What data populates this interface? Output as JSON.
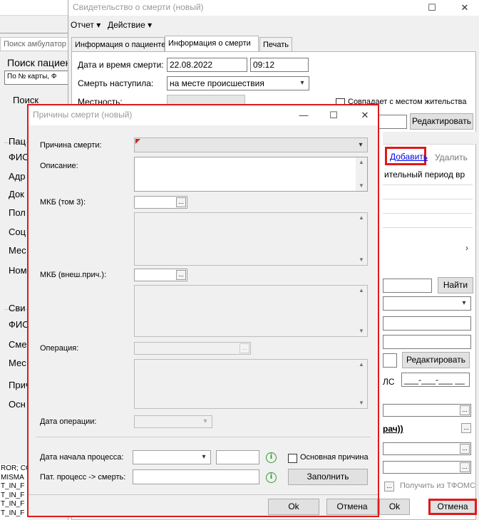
{
  "background_app": {
    "search_tab": "Поиск амбулатор",
    "panel_title": "Поиск пациен",
    "search_combo": "По № карты, Ф",
    "search_label": "Поиск",
    "patient_group": "Пац",
    "patient_fields": [
      "ФИО",
      "Адр",
      "Док",
      "Пол",
      "Соц",
      "Мес",
      "Ном"
    ],
    "visit_group": "Сви",
    "visit_fields": [
      "ФИО",
      "Сме",
      "Мес",
      "Прич",
      "Осн"
    ],
    "error_lines": [
      "ROR; CO",
      "MISMA",
      "T_IN_F",
      "T_IN_F",
      "T_IN_F",
      "T_IN_F"
    ]
  },
  "certificate_window": {
    "title": "Свидетельство о смерти (новый)",
    "menu": [
      "Отчет",
      "Действие"
    ],
    "tabs": [
      "Информация о пациенте",
      "Информация о смерти",
      "Печать"
    ],
    "death_datetime_label": "Дата и время смерти:",
    "death_date": "22.08.2022",
    "death_time": "09:12",
    "death_occurred_label": "Смерть наступила:",
    "death_occurred_value": "на месте происшествия",
    "locality_label": "Местность:",
    "same_as_residence_label": "Совпадает с местом жительства",
    "edit_button": "Редактировать",
    "add_link": "Добавить",
    "delete_link": "Удалить",
    "column_header": "ительный период вр",
    "find_button": "Найти",
    "edit_button_2": "Редактировать",
    "snils_label": "ЛС",
    "snils_mask": "___-___-___ __",
    "doctor_partial": "рач))",
    "tfoms_button": "Получить из ТФОМС",
    "ok_button": "Ok",
    "cancel_button": "Отмена"
  },
  "dialog": {
    "title": "Причины смерти (новый)",
    "cause_label": "Причина смерти:",
    "description_label": "Описание:",
    "mkb3_label": "МКБ (том 3):",
    "mkb_ext_label": "МКБ (внеш.прич.):",
    "operation_label": "Операция:",
    "operation_date_label": "Дата операции:",
    "process_start_label": "Дата начала процесса:",
    "main_cause_label": "Основная причина",
    "pat_process_label": "Пат. процесс -> смерть:",
    "fill_button": "Заполнить",
    "ok_button": "Ok",
    "cancel_button": "Отмена"
  },
  "icons": {
    "ellipsis": "...",
    "info": "i",
    "dropdown": "▾",
    "close": "✕",
    "maximize": "☐",
    "minimize": "—",
    "scroll_up": "▲",
    "scroll_down": "▼",
    "scroll_right": "›"
  },
  "colors": {
    "highlight": "#e0191b",
    "info_green": "#2e9a2e",
    "link": "#0000ee",
    "required_flag": "#d51f1f"
  }
}
